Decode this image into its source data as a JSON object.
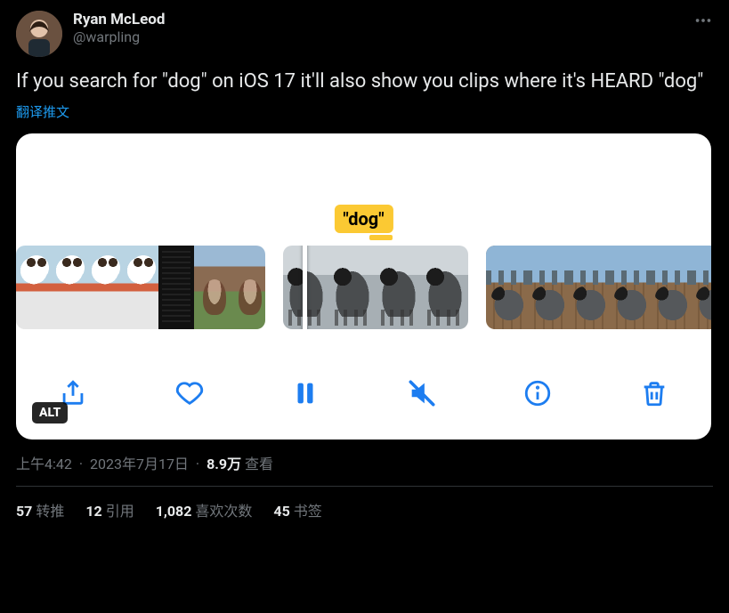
{
  "user": {
    "display_name": "Ryan McLeod",
    "handle": "@warpling"
  },
  "tweet": {
    "text": "If you search for \"dog\" on iOS 17 it'll also show you clips where it's HEARD \"dog\"",
    "translate_label": "翻译推文"
  },
  "media": {
    "search_chip": "\"dog\"",
    "alt_badge": "ALT"
  },
  "meta": {
    "time": "上午4:42",
    "date": "2023年7月17日",
    "separator": "·",
    "views_count": "8.9万",
    "views_label": "查看"
  },
  "stats": {
    "retweets": {
      "count": "57",
      "label": "转推"
    },
    "quotes": {
      "count": "12",
      "label": "引用"
    },
    "likes": {
      "count": "1,082",
      "label": "喜欢次数"
    },
    "bookmarks": {
      "count": "45",
      "label": "书签"
    }
  }
}
